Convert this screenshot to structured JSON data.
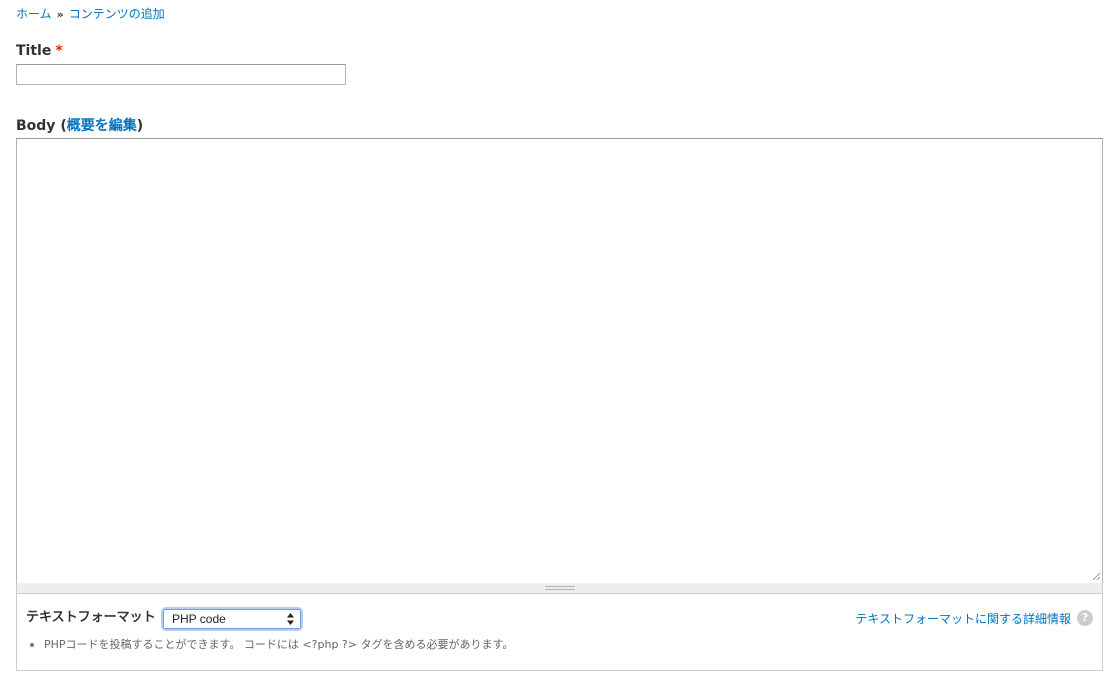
{
  "breadcrumb": {
    "home": "ホーム",
    "separator": "»",
    "current": "コンテンツの追加"
  },
  "title_field": {
    "label": "Title",
    "required_marker": "*",
    "value": ""
  },
  "body_field": {
    "label": "Body",
    "open_paren": "(",
    "summary_link": "概要を編集",
    "close_paren": ")",
    "value": ""
  },
  "text_format": {
    "label": "テキストフォーマット",
    "selected": "PHP code",
    "help_link": "テキストフォーマットに関する詳細情報",
    "help_icon": "?",
    "tips": [
      "PHPコードを投稿することができます。 コードには <?php ?> タグを含める必要があります。"
    ]
  },
  "colors": {
    "link": "#0074bd",
    "required": "#e32700",
    "border": "#cccccc"
  }
}
